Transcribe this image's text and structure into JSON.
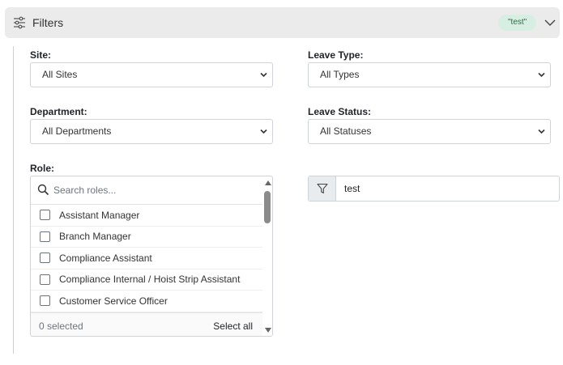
{
  "header": {
    "title": "Filters",
    "badge": "\"test\"",
    "icons": {
      "filters": "sliders-icon",
      "toggle": "chevron-down-icon"
    }
  },
  "fields": {
    "site": {
      "label": "Site:",
      "value": "All Sites"
    },
    "leave_type": {
      "label": "Leave Type:",
      "value": "All Types"
    },
    "department": {
      "label": "Department:",
      "value": "All Departments"
    },
    "leave_status": {
      "label": "Leave Status:",
      "value": "All Statuses"
    },
    "role": {
      "label": "Role:",
      "search_placeholder": "Search roles...",
      "items": [
        "Assistant Manager",
        "Branch Manager",
        "Compliance Assistant",
        "Compliance Internal / Hoist Strip Assistant",
        "Customer Service Officer"
      ],
      "selected_count": "0 selected",
      "select_all": "Select all"
    },
    "text_filter": {
      "value": "test",
      "icon": "funnel-icon"
    }
  },
  "colors": {
    "header_bg": "#ebebeb",
    "badge_bg": "#d7efe2",
    "badge_text": "#2d6a4a",
    "border": "#ced4da"
  }
}
